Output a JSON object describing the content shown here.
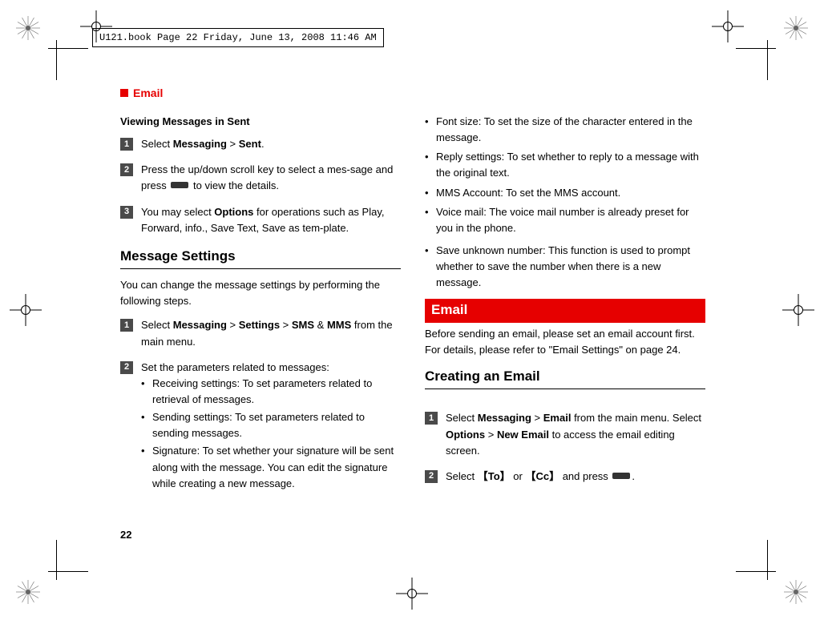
{
  "header": {
    "file_stamp": "U121.book  Page 22  Friday, June 13, 2008  11:46 AM",
    "section_marker": "Email"
  },
  "col1": {
    "viewing_heading": "Viewing Messages in Sent",
    "step1": {
      "pre": "Select ",
      "b1": "Messaging",
      "mid": " > ",
      "b2": "Sent",
      "post": "."
    },
    "step2": {
      "pre": "Press the up/down scroll key to select a mes-sage and press ",
      "post": " to view the details."
    },
    "step3": {
      "pre": "You may select ",
      "b1": "Options",
      "post": " for operations such as Play, Forward, info., Save Text, Save as tem-plate."
    },
    "msg_settings_heading": "Message Settings",
    "msg_settings_intro": "You can change the message settings by performing the following steps.",
    "ms_step1": {
      "pre": "Select ",
      "b1": "Messaging",
      "gt1": " > ",
      "b2": "Settings",
      "gt2": " > ",
      "b3": "SMS",
      "amp": " & ",
      "b4": "MMS",
      "post": " from the main menu."
    },
    "ms_step2_intro": "Set the parameters related to messages:",
    "ms_step2_items": [
      "Receiving settings: To set parameters related to retrieval of messages.",
      "Sending settings: To set parameters related to sending messages.",
      "Signature: To set whether your signature will be sent along with the message. You can edit the signature while creating a new message."
    ]
  },
  "col2": {
    "top_items": [
      "Font size: To set the size of the character entered in the message.",
      "Reply settings: To set whether to reply to a message with the original text.",
      "MMS Account: To set the MMS account.",
      "Voice mail: The voice mail number is already preset for you in the phone.",
      "Save unknown number: This function is used to prompt whether to save the number when there is a new message."
    ],
    "email_bar": "Email",
    "email_intro": "Before sending an email, please set an email account first. For details, please refer to \"Email Settings\" on page 24.",
    "creating_heading": "Creating an Email",
    "ce_step1": {
      "pre": "Select ",
      "b1": "Messaging",
      "gt": " > ",
      "b2": "Email",
      "post1": " from the main menu. Select ",
      "b3": "Options",
      "gt2": " > ",
      "b4": "New Email",
      "post2": " to access the email editing screen."
    },
    "ce_step2": {
      "pre": "Select ",
      "to": "【To】",
      "or": " or ",
      "cc": "【Cc】",
      "mid": " and press ",
      "post": "."
    }
  },
  "page_number": "22",
  "step_numbers": [
    "1",
    "2",
    "3"
  ]
}
